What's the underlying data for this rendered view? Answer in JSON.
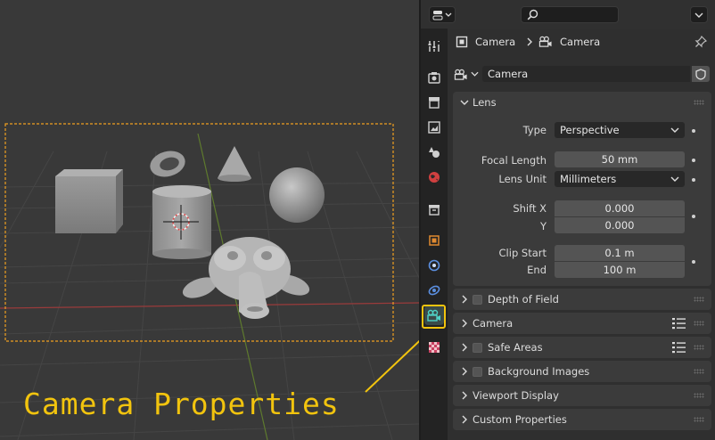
{
  "annotation": {
    "label": "Camera Properties"
  },
  "header": {
    "search_placeholder": ""
  },
  "breadcrumb": {
    "object_name": "Camera",
    "data_name": "Camera"
  },
  "datablock": {
    "name": "Camera"
  },
  "tabs": [
    {
      "icon": "tool-icon"
    },
    {
      "icon": "render-icon"
    },
    {
      "icon": "output-icon"
    },
    {
      "icon": "view-layer-icon"
    },
    {
      "icon": "scene-icon"
    },
    {
      "icon": "world-icon"
    },
    {
      "icon": "collection-icon"
    },
    {
      "icon": "object-icon"
    },
    {
      "icon": "modifier-physics-icon"
    },
    {
      "icon": "constraint-icon"
    },
    {
      "icon": "camera-data-icon",
      "active": true
    },
    {
      "icon": "texture-icon"
    }
  ],
  "lens": {
    "title": "Lens",
    "type_label": "Type",
    "type_value": "Perspective",
    "focal_label": "Focal Length",
    "focal_value": "50 mm",
    "unit_label": "Lens Unit",
    "unit_value": "Millimeters",
    "shiftx_label": "Shift X",
    "shiftx_value": "0.000",
    "shifty_label": "Y",
    "shifty_value": "0.000",
    "clipstart_label": "Clip Start",
    "clipstart_value": "0.1 m",
    "clipend_label": "End",
    "clipend_value": "100 m"
  },
  "panels": {
    "dof": "Depth of Field",
    "camera": "Camera",
    "safe": "Safe Areas",
    "bg": "Background Images",
    "vp": "Viewport Display",
    "custom": "Custom Properties"
  },
  "colors": {
    "accent": "#f2c40e",
    "active_tab": "#4fd1c5"
  }
}
